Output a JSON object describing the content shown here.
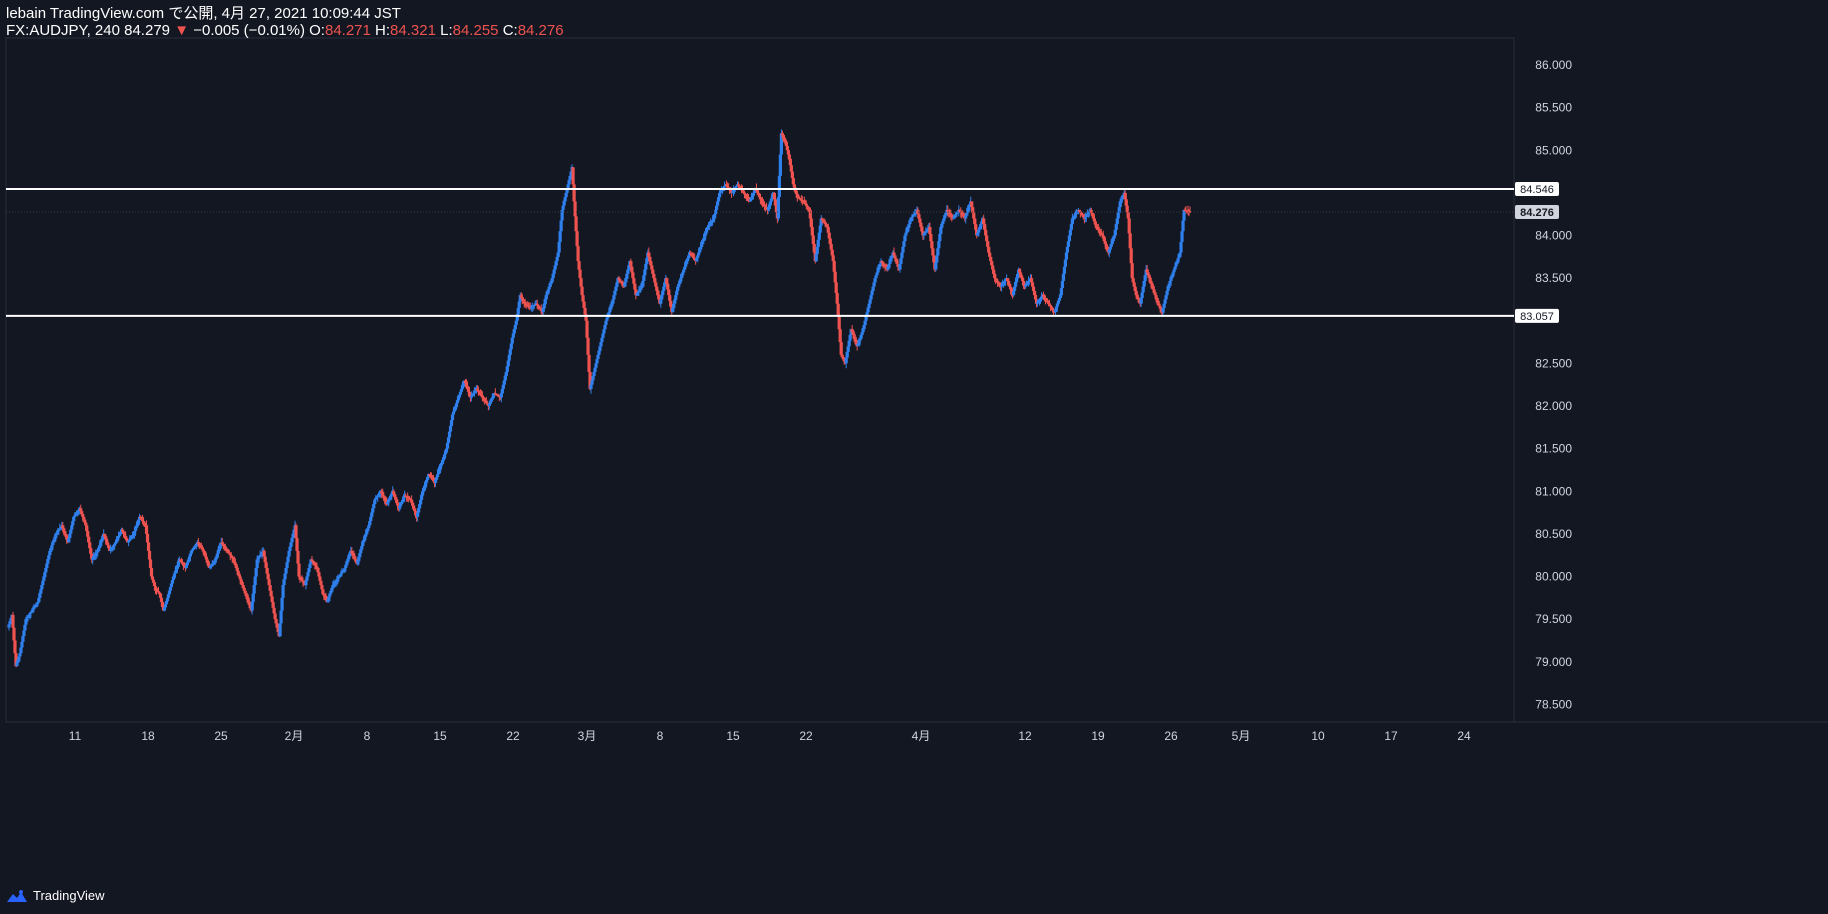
{
  "header": {
    "publisher": "lebain TradingView.com で公開, 4月 27, 2021 10:09:44 JST",
    "symbol": "FX:AUDJPY, 240",
    "last": "84.279",
    "change_arrow": "▼",
    "change": "−0.005 (−0.01%)",
    "o_label": "O:",
    "o": "84.271",
    "h_label": "H:",
    "h": "84.321",
    "l_label": "L:",
    "l": "84.255",
    "c_label": "C:",
    "c": "84.276"
  },
  "footer": {
    "brand": "TradingView"
  },
  "colors": {
    "background": "#131722",
    "up": "#2962ff",
    "up_line": "#2f80ed",
    "down": "#ef5350",
    "axis_text": "#d1d4dc",
    "level_line": "#ffffff"
  },
  "chart_data": {
    "type": "candlestick",
    "symbol": "FX:AUDJPY",
    "interval": "240",
    "ylim": [
      78.2,
      86.2
    ],
    "y_ticks": [
      "86.000",
      "85.500",
      "85.000",
      "84.000",
      "83.500",
      "82.500",
      "82.000",
      "81.500",
      "81.000",
      "80.500",
      "80.000",
      "79.500",
      "79.000",
      "78.500"
    ],
    "x_ticks": [
      "11",
      "18",
      "25",
      "2月",
      "8",
      "15",
      "22",
      "3月",
      "8",
      "15",
      "22",
      "4月",
      "12",
      "19",
      "26",
      "5月",
      "10",
      "17",
      "24"
    ],
    "horizontal_levels": [
      {
        "value": 84.546,
        "label": "84.546"
      },
      {
        "value": 83.057,
        "label": "83.057"
      }
    ],
    "current_price": {
      "value": 84.276,
      "label": "84.276"
    },
    "path": [
      [
        0,
        79.4
      ],
      [
        4,
        79.55
      ],
      [
        8,
        78.95
      ],
      [
        12,
        79.1
      ],
      [
        18,
        79.5
      ],
      [
        24,
        79.6
      ],
      [
        30,
        79.7
      ],
      [
        36,
        80.0
      ],
      [
        42,
        80.3
      ],
      [
        48,
        80.5
      ],
      [
        54,
        80.6
      ],
      [
        60,
        80.4
      ],
      [
        66,
        80.7
      ],
      [
        72,
        80.8
      ],
      [
        78,
        80.6
      ],
      [
        84,
        80.2
      ],
      [
        90,
        80.3
      ],
      [
        96,
        80.5
      ],
      [
        102,
        80.3
      ],
      [
        108,
        80.4
      ],
      [
        114,
        80.55
      ],
      [
        120,
        80.4
      ],
      [
        126,
        80.5
      ],
      [
        132,
        80.7
      ],
      [
        138,
        80.6
      ],
      [
        144,
        80.0
      ],
      [
        148,
        79.85
      ],
      [
        152,
        79.8
      ],
      [
        156,
        79.6
      ],
      [
        160,
        79.75
      ],
      [
        166,
        80.0
      ],
      [
        172,
        80.2
      ],
      [
        178,
        80.1
      ],
      [
        184,
        80.3
      ],
      [
        190,
        80.4
      ],
      [
        196,
        80.3
      ],
      [
        202,
        80.1
      ],
      [
        208,
        80.2
      ],
      [
        214,
        80.4
      ],
      [
        220,
        80.3
      ],
      [
        226,
        80.2
      ],
      [
        232,
        80.0
      ],
      [
        238,
        79.8
      ],
      [
        244,
        79.6
      ],
      [
        250,
        80.2
      ],
      [
        256,
        80.3
      ],
      [
        262,
        79.9
      ],
      [
        268,
        79.5
      ],
      [
        272,
        79.3
      ],
      [
        276,
        79.9
      ],
      [
        282,
        80.3
      ],
      [
        288,
        80.6
      ],
      [
        292,
        80.0
      ],
      [
        298,
        79.9
      ],
      [
        304,
        80.2
      ],
      [
        310,
        80.1
      ],
      [
        316,
        79.8
      ],
      [
        320,
        79.7
      ],
      [
        326,
        79.9
      ],
      [
        332,
        80.0
      ],
      [
        338,
        80.1
      ],
      [
        344,
        80.3
      ],
      [
        350,
        80.15
      ],
      [
        356,
        80.4
      ],
      [
        362,
        80.6
      ],
      [
        368,
        80.9
      ],
      [
        374,
        81.0
      ],
      [
        380,
        80.85
      ],
      [
        386,
        81.0
      ],
      [
        392,
        80.8
      ],
      [
        398,
        80.95
      ],
      [
        404,
        80.9
      ],
      [
        410,
        80.7
      ],
      [
        416,
        81.0
      ],
      [
        422,
        81.2
      ],
      [
        428,
        81.1
      ],
      [
        434,
        81.3
      ],
      [
        440,
        81.5
      ],
      [
        446,
        81.9
      ],
      [
        452,
        82.1
      ],
      [
        458,
        82.3
      ],
      [
        464,
        82.1
      ],
      [
        470,
        82.2
      ],
      [
        476,
        82.1
      ],
      [
        482,
        82.0
      ],
      [
        488,
        82.15
      ],
      [
        494,
        82.1
      ],
      [
        500,
        82.4
      ],
      [
        506,
        82.8
      ],
      [
        510,
        83.0
      ],
      [
        514,
        83.3
      ],
      [
        518,
        83.2
      ],
      [
        524,
        83.15
      ],
      [
        530,
        83.2
      ],
      [
        536,
        83.1
      ],
      [
        540,
        83.3
      ],
      [
        546,
        83.5
      ],
      [
        552,
        83.8
      ],
      [
        556,
        84.3
      ],
      [
        562,
        84.6
      ],
      [
        566,
        84.8
      ],
      [
        568,
        84.4
      ],
      [
        572,
        83.7
      ],
      [
        576,
        83.3
      ],
      [
        580,
        83.0
      ],
      [
        584,
        82.2
      ],
      [
        588,
        82.4
      ],
      [
        594,
        82.7
      ],
      [
        600,
        83.0
      ],
      [
        606,
        83.2
      ],
      [
        612,
        83.5
      ],
      [
        618,
        83.4
      ],
      [
        624,
        83.7
      ],
      [
        630,
        83.3
      ],
      [
        636,
        83.4
      ],
      [
        642,
        83.8
      ],
      [
        648,
        83.5
      ],
      [
        654,
        83.2
      ],
      [
        660,
        83.5
      ],
      [
        666,
        83.1
      ],
      [
        672,
        83.4
      ],
      [
        678,
        83.6
      ],
      [
        684,
        83.8
      ],
      [
        690,
        83.7
      ],
      [
        696,
        83.9
      ],
      [
        702,
        84.1
      ],
      [
        708,
        84.2
      ],
      [
        714,
        84.5
      ],
      [
        720,
        84.6
      ],
      [
        726,
        84.5
      ],
      [
        732,
        84.6
      ],
      [
        738,
        84.5
      ],
      [
        744,
        84.4
      ],
      [
        750,
        84.55
      ],
      [
        756,
        84.4
      ],
      [
        762,
        84.3
      ],
      [
        768,
        84.5
      ],
      [
        772,
        84.2
      ],
      [
        776,
        85.2
      ],
      [
        780,
        85.1
      ],
      [
        784,
        84.9
      ],
      [
        788,
        84.6
      ],
      [
        792,
        84.45
      ],
      [
        798,
        84.4
      ],
      [
        804,
        84.3
      ],
      [
        810,
        83.7
      ],
      [
        816,
        84.2
      ],
      [
        822,
        84.1
      ],
      [
        828,
        83.7
      ],
      [
        832,
        83.2
      ],
      [
        836,
        82.6
      ],
      [
        840,
        82.5
      ],
      [
        846,
        82.9
      ],
      [
        852,
        82.7
      ],
      [
        858,
        82.9
      ],
      [
        864,
        83.2
      ],
      [
        870,
        83.5
      ],
      [
        876,
        83.7
      ],
      [
        882,
        83.6
      ],
      [
        888,
        83.8
      ],
      [
        894,
        83.6
      ],
      [
        900,
        84.0
      ],
      [
        906,
        84.2
      ],
      [
        912,
        84.3
      ],
      [
        918,
        84.0
      ],
      [
        924,
        84.1
      ],
      [
        930,
        83.6
      ],
      [
        936,
        84.1
      ],
      [
        942,
        84.3
      ],
      [
        948,
        84.2
      ],
      [
        954,
        84.3
      ],
      [
        960,
        84.2
      ],
      [
        966,
        84.4
      ],
      [
        972,
        84.0
      ],
      [
        978,
        84.2
      ],
      [
        984,
        83.8
      ],
      [
        990,
        83.5
      ],
      [
        996,
        83.4
      ],
      [
        1002,
        83.5
      ],
      [
        1008,
        83.3
      ],
      [
        1014,
        83.6
      ],
      [
        1020,
        83.4
      ],
      [
        1026,
        83.5
      ],
      [
        1032,
        83.2
      ],
      [
        1038,
        83.3
      ],
      [
        1044,
        83.2
      ],
      [
        1050,
        83.1
      ],
      [
        1056,
        83.3
      ],
      [
        1062,
        83.8
      ],
      [
        1068,
        84.2
      ],
      [
        1074,
        84.3
      ],
      [
        1080,
        84.2
      ],
      [
        1086,
        84.3
      ],
      [
        1092,
        84.1
      ],
      [
        1098,
        84.0
      ],
      [
        1104,
        83.8
      ],
      [
        1110,
        84.0
      ],
      [
        1116,
        84.4
      ],
      [
        1120,
        84.5
      ],
      [
        1124,
        84.2
      ],
      [
        1128,
        83.5
      ],
      [
        1132,
        83.3
      ],
      [
        1136,
        83.2
      ],
      [
        1142,
        83.6
      ],
      [
        1148,
        83.4
      ],
      [
        1154,
        83.2
      ],
      [
        1158,
        83.1
      ],
      [
        1164,
        83.4
      ],
      [
        1170,
        83.6
      ],
      [
        1176,
        83.8
      ],
      [
        1180,
        84.3
      ],
      [
        1186,
        84.28
      ]
    ]
  }
}
